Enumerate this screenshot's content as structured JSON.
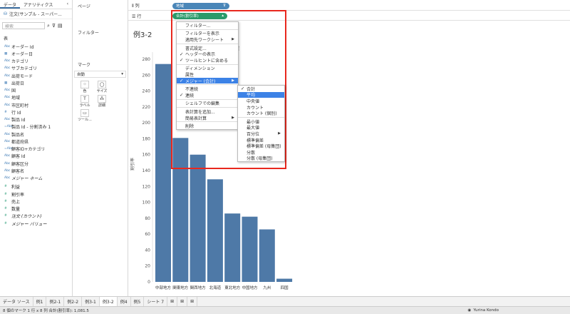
{
  "left_pane": {
    "tabs": [
      "データ",
      "アナリティクス"
    ],
    "collapse": "‹",
    "datasource": "注文(サンプル - スーパー...",
    "search_placeholder": "検索",
    "table_label": "表",
    "fields": [
      {
        "icon": "Abc",
        "name": "オーダー Id",
        "kind": "dim"
      },
      {
        "icon": "▦",
        "name": "オーダー日",
        "kind": "dim"
      },
      {
        "icon": "Abc",
        "name": "カテゴリ",
        "kind": "dim"
      },
      {
        "icon": "Abc",
        "name": "サブカテゴリ",
        "kind": "dim"
      },
      {
        "icon": "Abc",
        "name": "出荷モード",
        "kind": "dim"
      },
      {
        "icon": "▦",
        "name": "出荷日",
        "kind": "dim"
      },
      {
        "icon": "Abc",
        "name": "国",
        "kind": "dim"
      },
      {
        "icon": "Abc",
        "name": "地域",
        "kind": "dim"
      },
      {
        "icon": "Abc",
        "name": "市区町村",
        "kind": "dim"
      },
      {
        "icon": "#",
        "name": "行 Id",
        "kind": "dim"
      },
      {
        "icon": "Abc",
        "name": "製品 Id",
        "kind": "dim"
      },
      {
        "icon": "=Abc",
        "name": "製品 Id - 分割済み 1",
        "kind": "dim"
      },
      {
        "icon": "Abc",
        "name": "製品名",
        "kind": "dim"
      },
      {
        "icon": "Abc",
        "name": "都道府県",
        "kind": "dim"
      },
      {
        "icon": "=Abc",
        "name": "顧客ID+カテゴリ",
        "kind": "dim"
      },
      {
        "icon": "Abc",
        "name": "顧客 Id",
        "kind": "dim"
      },
      {
        "icon": "Abc",
        "name": "顧客区分",
        "kind": "dim"
      },
      {
        "icon": "Abc",
        "name": "顧客名",
        "kind": "dim"
      },
      {
        "icon": "Abc",
        "name": "メジャー ネーム",
        "kind": "dim",
        "italic": true
      },
      {
        "icon": "#",
        "name": "利益",
        "kind": "meas"
      },
      {
        "icon": "#",
        "name": "割引率",
        "kind": "meas"
      },
      {
        "icon": "#",
        "name": "売上",
        "kind": "meas"
      },
      {
        "icon": "#",
        "name": "数量",
        "kind": "meas"
      },
      {
        "icon": "#",
        "name": "注文 (カウント)",
        "kind": "meas",
        "italic": true
      },
      {
        "icon": "#",
        "name": "メジャー バリュー",
        "kind": "meas",
        "italic": true
      }
    ]
  },
  "mid_pane": {
    "pages": "ページ",
    "filters": "フィルター",
    "marks": "マーク",
    "mark_type": "自動",
    "mark_buttons": [
      {
        "icon": "⁘",
        "label": "色"
      },
      {
        "icon": "◯",
        "label": "サイズ"
      },
      {
        "icon": "T",
        "label": "ラベル"
      },
      {
        "icon": "⁂",
        "label": "詳細"
      },
      {
        "icon": "▭",
        "label": "ツール..."
      }
    ]
  },
  "shelves": {
    "columns_label": "列",
    "columns_pill": "地域",
    "rows_label": "行",
    "rows_pill": "合計(割引率)",
    "rows_pill_caret": "▴"
  },
  "sheet_title": "例3-2",
  "context_menu": {
    "items": [
      {
        "label": "フィルター...",
        "sep_before": false
      },
      {
        "label": "フィルターを表示",
        "sep_before": true
      },
      {
        "label": "適用先ワークシート",
        "arrow": true
      },
      {
        "label": "書式設定...",
        "sep_before": true
      },
      {
        "label": "ヘッダーの表示",
        "check": true
      },
      {
        "label": "ツールヒントに含める",
        "check": true
      },
      {
        "label": "ディメンション",
        "sep_before": true
      },
      {
        "label": "属性"
      },
      {
        "label": "メジャー (合計)",
        "check": true,
        "arrow": true,
        "highlight": true
      },
      {
        "label": "不連続",
        "sep_before": true
      },
      {
        "label": "連続",
        "check": true
      },
      {
        "label": "シェルフでの編集",
        "sep_before": true
      },
      {
        "label": "表計算を追加...",
        "sep_before": true
      },
      {
        "label": "簡易表計算",
        "arrow": true
      },
      {
        "label": "削除",
        "sep_before": true
      }
    ]
  },
  "submenu": {
    "items": [
      {
        "label": "合計",
        "check": true
      },
      {
        "label": "平均",
        "highlight": true
      },
      {
        "label": "中央値"
      },
      {
        "label": "カウント"
      },
      {
        "label": "カウント (個別)"
      },
      {
        "label": "最小値",
        "sep_before": true
      },
      {
        "label": "最大値"
      },
      {
        "label": "百分位",
        "arrow": true
      },
      {
        "label": "標準偏差"
      },
      {
        "label": "標準偏差 (母集団)"
      },
      {
        "label": "分散"
      },
      {
        "label": "分散 (母集団)"
      }
    ]
  },
  "chart_data": {
    "type": "bar",
    "categories": [
      "中部地方",
      "関東地方",
      "関西地方",
      "北海道",
      "東北地方",
      "中国地方",
      "九州",
      "四国"
    ],
    "values": [
      274,
      181,
      160,
      129,
      86,
      82,
      66,
      4
    ],
    "ylabel": "割引率",
    "ylim": [
      0,
      280
    ],
    "yticks": [
      0,
      20,
      40,
      60,
      80,
      100,
      120,
      140,
      160,
      180,
      200,
      220,
      240,
      260,
      280
    ],
    "xlabel": "地域",
    "bar_color": "#4e79a7"
  },
  "bottom_tabs": [
    "データ ソース",
    "例1",
    "例2-1",
    "例2-2",
    "例3-1",
    "例3-2",
    "例4",
    "例5",
    "シート 7"
  ],
  "active_tab": "例3-2",
  "status": {
    "left": "8 個のマーク   1 行 x 8 列   合計(割引率): 1,081.5",
    "user": "Yurina Kondo"
  },
  "colors": {
    "accent": "#3c82e6",
    "highlight_box": "#e8281e",
    "pill_dim": "#4a86b8",
    "pill_meas": "#2a9a6a"
  }
}
